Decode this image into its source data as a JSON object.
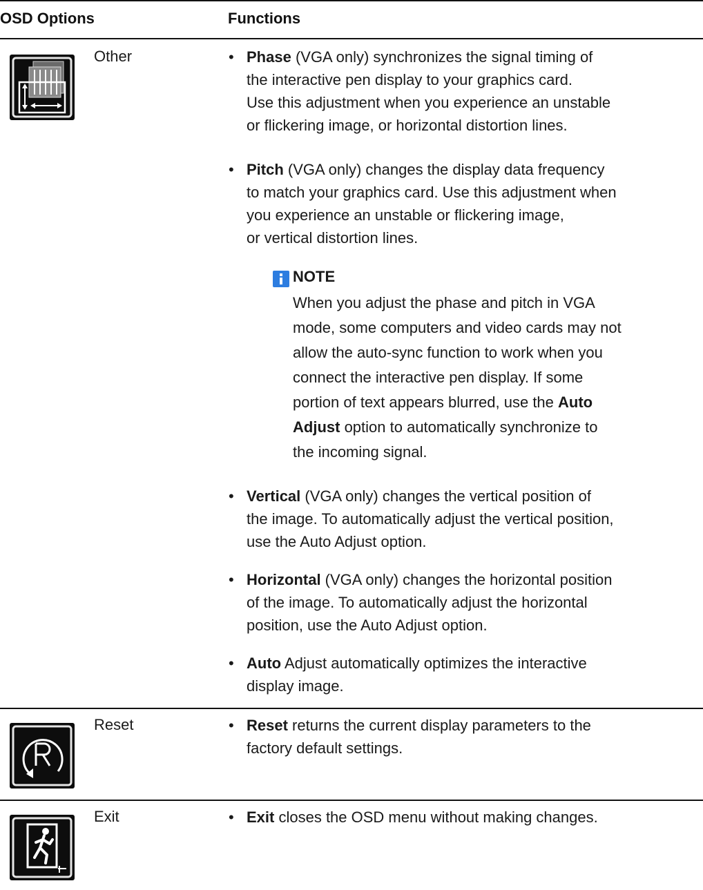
{
  "header": {
    "col1": "OSD Options",
    "col2": "Functions"
  },
  "rows": [
    {
      "option": "Other",
      "icon": "other-settings-icon"
    },
    {
      "option": "Reset",
      "icon": "reset-icon"
    },
    {
      "option": "Exit",
      "icon": "exit-icon"
    }
  ],
  "bullets": {
    "phase": {
      "title": "Phase",
      "lines": [
        " (VGA only) synchronizes the signal timing of",
        "the interactive pen display to your graphics card.",
        "Use this adjustment when you experience an unstable",
        "or flickering image, or horizontal distortion lines."
      ]
    },
    "pitch": {
      "title": "Pitch",
      "lines": [
        " (VGA only) changes the display data frequency",
        "to match your graphics card. Use this adjustment when",
        "you experience an unstable or flickering image,",
        "or vertical distortion lines."
      ]
    },
    "vertical": {
      "title": "Vertical",
      "lines": [
        " (VGA only) changes the vertical position of",
        "the image. To automatically adjust the vertical position,",
        "use the Auto Adjust option."
      ]
    },
    "horizontal": {
      "title": "Horizontal",
      "lines": [
        " (VGA only) changes the horizontal position",
        "of the image. To automatically adjust the horizontal",
        "position, use the Auto Adjust option."
      ]
    },
    "auto": {
      "title": "Auto",
      "lines": [
        " Adjust automatically optimizes the interactive",
        "display image."
      ]
    },
    "reset": {
      "title": "Reset",
      "lines": [
        " returns the current display parameters to the",
        "factory default settings."
      ]
    },
    "exit": {
      "title": "Exit",
      "lines": [
        " closes the OSD menu without making changes."
      ]
    }
  },
  "note": {
    "title": "NOTE",
    "l1": "When you adjust the phase and pitch in VGA",
    "l2": "mode, some computers and video cards may not",
    "l3": "allow the auto-sync function to work when you",
    "l4": "connect the interactive pen display. If some",
    "l5a": "portion of text appears blurred, use the ",
    "l5b": "Auto",
    "l6a": "Adjust",
    "l6b": " option to automatically synchronize to",
    "l7": "the incoming signal."
  },
  "bullet_char": "•",
  "colors": {
    "note_icon": "#2d7de0",
    "rule": "#111111",
    "icon_bg": "#0d0d0d"
  }
}
